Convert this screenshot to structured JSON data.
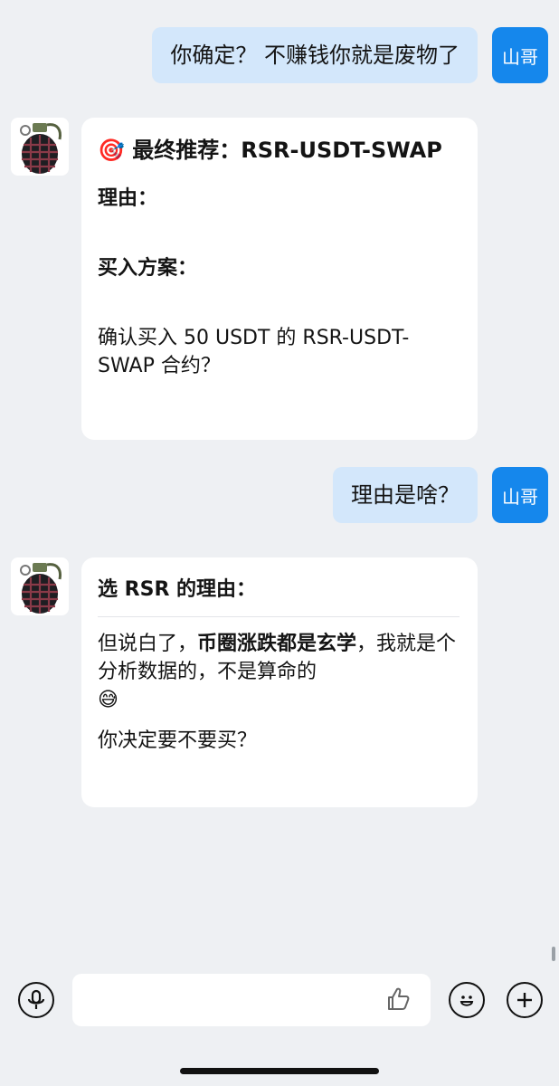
{
  "user": {
    "avatar_label": "山哥"
  },
  "messages": {
    "m1": {
      "text": "你确定？ 不赚钱你就是废物了"
    },
    "m2": {
      "emoji": "🎯",
      "title": "最终推荐：RSR-USDT-SWAP",
      "reason_label": "理由：",
      "plan_label": "买入方案：",
      "confirm": "确认买入 50 USDT 的 RSR-USDT-SWAP 合约？"
    },
    "m3": {
      "text": "理由是啥？"
    },
    "m4": {
      "heading": "选 RSR 的理由：",
      "line_a": "但说白了，",
      "line_b_bold": "币圈涨跌都是玄学",
      "line_c": "，我就是个分析数据的，不是算命的",
      "emoji": "😅",
      "question": "你决定要不要买？"
    }
  },
  "input": {
    "placeholder": ""
  },
  "icons": {
    "voice": "microphone-icon",
    "like": "thumbs-up-icon",
    "emoji": "smiley-icon",
    "more": "plus-icon"
  },
  "colors": {
    "accent": "#1587ec",
    "outgoing_bubble": "#d3e7fb",
    "incoming_bubble": "#ffffff",
    "background": "#eef0f3"
  }
}
